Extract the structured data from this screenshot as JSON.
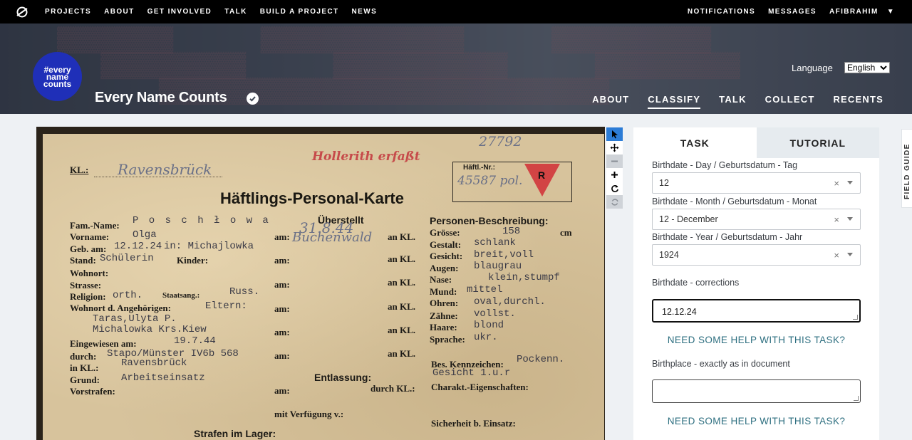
{
  "topnav": {
    "links": [
      "PROJECTS",
      "ABOUT",
      "GET INVOLVED",
      "TALK",
      "BUILD A PROJECT",
      "NEWS"
    ],
    "right": [
      "NOTIFICATIONS",
      "MESSAGES",
      "AFIBRAHIM"
    ]
  },
  "project": {
    "logo_lines": [
      "#every",
      "name",
      "counts"
    ],
    "title": "Every Name Counts",
    "language_label": "Language",
    "language_value": "English",
    "nav": [
      "ABOUT",
      "CLASSIFY",
      "TALK",
      "COLLECT",
      "RECENTS"
    ],
    "active_nav": "CLASSIFY"
  },
  "card": {
    "stamp": "Hollerith erfaßt",
    "number_hw": "27792",
    "haftl_nr_label": "Häftl.-Nr.:",
    "haftl_nr_hw": "45587 pol.",
    "triangle_letter": "R",
    "kl_label": "KL.:",
    "kl_value": "Ravensbrück",
    "title": "Häftlings-Personal-Karte",
    "left_labels": [
      "Fam.-Name:",
      "Vorname:",
      "Geb. am:",
      "Stand:",
      "Wohnort:",
      "Strasse:",
      "Religion:",
      "Wohnort d. Angehörigen:",
      "Eingewiesen am:",
      "durch:",
      "in KL.:",
      "Grund:",
      "Vorstrafen:"
    ],
    "left_values": {
      "fam_name": "P o s c h ł o w a",
      "vorname": "Olga",
      "geb_am": "12.12.24",
      "geb_in": "in: Michajlowka",
      "stand": "Schülerin",
      "kinder_label": "Kinder:",
      "religion": "orth.",
      "staatsang_label": "Staatsang.:",
      "staatsang": "Russ.",
      "angeh": "Eltern:",
      "angeh2": "Taras,Ulyta P.",
      "angeh3": "Michalowka Krs.Kiew",
      "eingewiesen": "19.7.44",
      "durch": "Stapo/Münster IV6b 568",
      "in_kl": "Ravensbrück",
      "grund": "Arbeitseinsatz"
    },
    "middle": {
      "uberstellt": "Überstellt",
      "am_label": "am:",
      "an_kl": "an KL.",
      "am_hw": "31.8.44",
      "an_hw": "Buchenwald",
      "entlassung": "Entlassung:",
      "durch_kl": "durch KL.:",
      "verfuegung": "mit Verfügung v.:"
    },
    "right": {
      "heading": "Personen-Beschreibung:",
      "labels": [
        "Grösse:",
        "Gestalt:",
        "Gesicht:",
        "Augen:",
        "Nase:",
        "Mund:",
        "Ohren:",
        "Zähne:",
        "Haare:",
        "Sprache:"
      ],
      "values": [
        "158",
        "schlank",
        "breit,voll",
        "blaugrau",
        "klein,stumpf",
        "mittel",
        "oval,durchl.",
        "vollst.",
        "blond",
        "ukr."
      ],
      "unit": "cm",
      "bes_label": "Bes. Kennzeichen:",
      "bes_value": "Pockenn.",
      "bes_value2": "Gesicht 1.u.r",
      "charakt": "Charakt.-Eigenschaften:",
      "sicherheit": "Sicherheit b. Einsatz:"
    },
    "strafen": "Strafen im Lager:"
  },
  "tools": [
    "pointer-tool",
    "move-tool",
    "zoom-out-tool",
    "zoom-in-tool",
    "rotate-tool",
    "reset-tool"
  ],
  "panel": {
    "tab_task": "TASK",
    "tab_tutorial": "TUTORIAL",
    "day_label": "Birthdate - Day / Geburtsdatum - Tag",
    "day_value": "12",
    "month_label": "Birthdate - Month / Geburtsdatum - Monat",
    "month_value": "12 - December",
    "year_label": "Birthdate - Year / Geburtsdatum - Jahr",
    "year_value": "1924",
    "corrections_label": "Birthdate - corrections",
    "corrections_value": "12.12.24",
    "help_text": "NEED SOME HELP WITH THIS TASK?",
    "birthplace_label": "Birthplace - exactly as in document",
    "birthplace_value": "",
    "help_text_2": "NEED SOME HELP WITH THIS TASK?",
    "clear_glyph": "×"
  },
  "field_guide": "FIELD GUIDE"
}
